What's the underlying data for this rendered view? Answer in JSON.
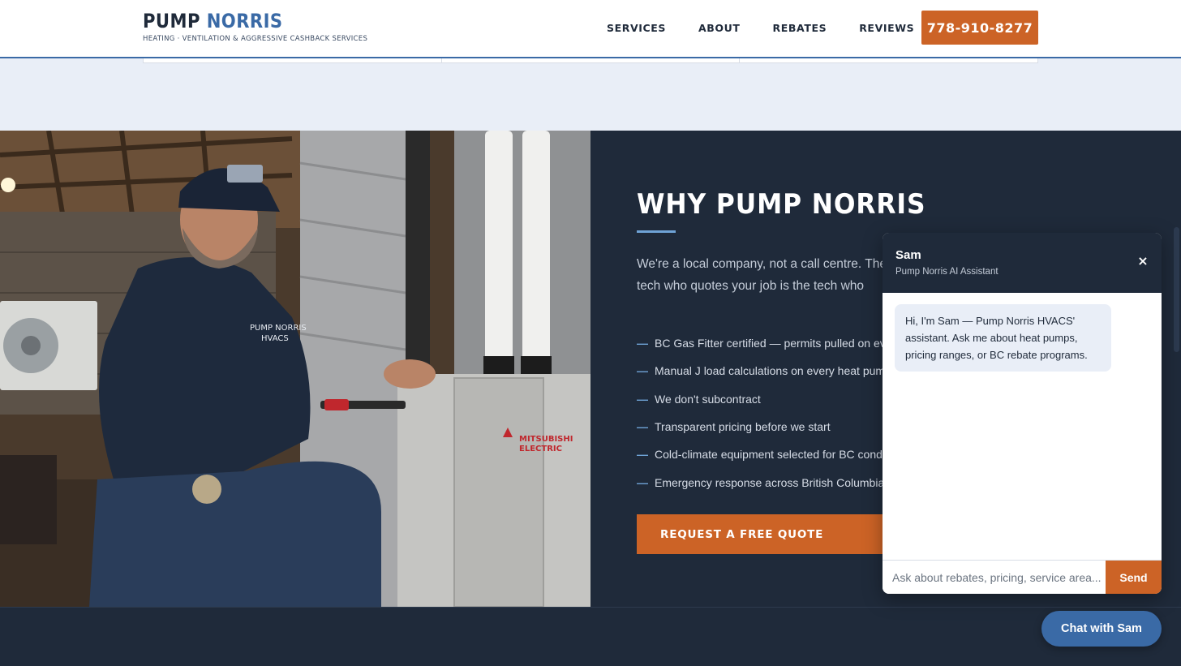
{
  "header": {
    "logo_primary": "PUMP",
    "logo_accent": "NORRIS",
    "tagline": "HEATING · VENTILATION & AGGRESSIVE CASHBACK SERVICES",
    "nav": [
      "SERVICES",
      "ABOUT",
      "REBATES",
      "REVIEWS"
    ],
    "phone": "778-910-8277"
  },
  "why": {
    "title": "WHY PUMP NORRIS",
    "intro": "We're a local company, not a call centre. The tech who quotes your job is the tech who installs it.",
    "bullets": [
      "BC Gas Fitter certified — permits pulled on every job",
      "Manual J load calculations on every heat pump",
      "We don't subcontract",
      "Transparent pricing before we start",
      "Cold-climate equipment selected for BC conditions",
      "Emergency response across British Columbia"
    ],
    "cta": "REQUEST A FREE QUOTE"
  },
  "photo": {
    "shirt_text_line1": "PUMP NORRIS",
    "shirt_text_line2": "HVACS",
    "unit_brand_line1": "MITSUBISHI",
    "unit_brand_line2": "ELECTRIC"
  },
  "chat": {
    "name": "Sam",
    "subtitle": "Pump Norris AI Assistant",
    "close_icon": "×",
    "greeting": "Hi, I'm Sam — Pump Norris HVACS' assistant. Ask me about heat pumps, pricing ranges, or BC rebate programs.",
    "input_placeholder": "Ask about rebates, pricing, service area...",
    "send_label": "Send",
    "launcher_label": "Chat with Sam"
  },
  "colors": {
    "navy": "#1f2a3a",
    "accent_blue": "#3a6aa6",
    "accent_orange": "#cc6326",
    "light_band": "#e9eef7"
  }
}
